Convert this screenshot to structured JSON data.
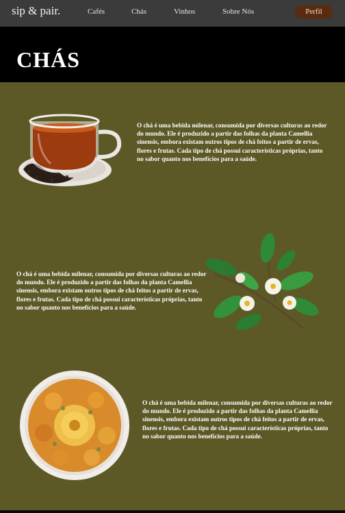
{
  "nav": {
    "logo": "sip & pair.",
    "links": [
      "Cafés",
      "Chás",
      "Vinhos",
      "Sobre Nós"
    ],
    "profile_label": "Perfil"
  },
  "hero": {
    "title": "CHÁS"
  },
  "sections": [
    {
      "image_icon": "tea-cup",
      "text": "O chá é uma bebida milenar, consumida por diversas culturas ao redor do mundo. Ele é produzido a partir das folhas da planta Camellia sinensis, embora existam outros tipos de chá feitos a partir de ervas, flores e frutas. Cada tipo de chá possui características próprias, tanto no sabor quanto nos benefícios para a saúde."
    },
    {
      "image_icon": "tea-plant",
      "text": "O chá é uma bebida milenar, consumida por diversas culturas ao redor do mundo. Ele é produzido a partir das folhas da planta Camellia sinensis, embora existam outros tipos de chá feitos a partir de ervas, flores e frutas. Cada tipo de chá possui características próprias, tanto no sabor quanto nos benefícios para a saúde."
    },
    {
      "image_icon": "dried-flowers",
      "text": "O chá é uma bebida milenar, consumida por diversas culturas ao redor do mundo. Ele é produzido a partir das folhas da planta Camellia sinensis, embora existam outros tipos de chá feitos a partir de ervas, flores e frutas. Cada tipo de chá possui características próprias, tanto no sabor quanto nos benefícios para a saúde."
    }
  ],
  "colors": {
    "navbar": "#3b3b3b",
    "hero": "#000000",
    "content": "#5c5927",
    "profile_button": "#5a2b0e"
  }
}
